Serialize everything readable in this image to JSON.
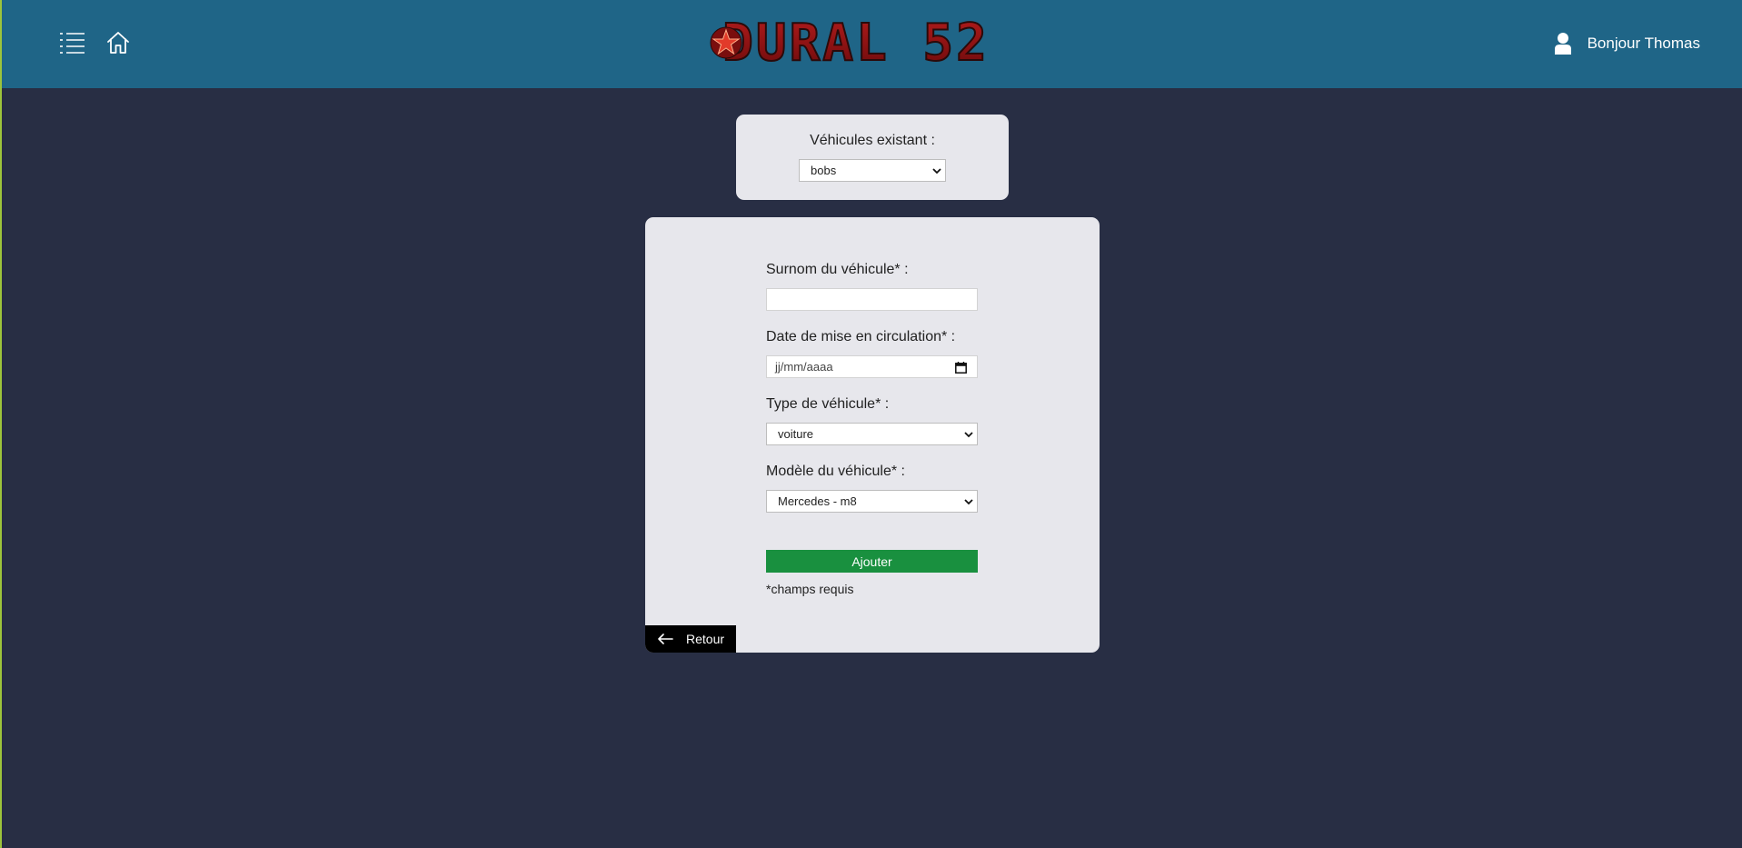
{
  "header": {
    "logo_text": "DURAL 52",
    "greeting": "Bonjour Thomas",
    "colors": {
      "bar": "#1f6587",
      "logo_red": "#8b0f10"
    },
    "icons": [
      "menu-icon",
      "home-icon",
      "user-icon",
      "star-icon"
    ]
  },
  "existing_vehicles": {
    "label": "Véhicules existant :",
    "selected": "bobs"
  },
  "form": {
    "nickname": {
      "label": "Surnom du véhicule* :",
      "value": ""
    },
    "date": {
      "label": "Date de mise en circulation* :",
      "placeholder": "jj/mm/aaaa"
    },
    "type": {
      "label": "Type de véhicule* :",
      "selected": "voiture"
    },
    "model": {
      "label": "Modèle du véhicule* :",
      "selected": "Mercedes - m8"
    },
    "submit_label": "Ajouter",
    "required_note": "*champs requis",
    "submit_color": "#19903f"
  },
  "back": {
    "label": "Retour"
  }
}
